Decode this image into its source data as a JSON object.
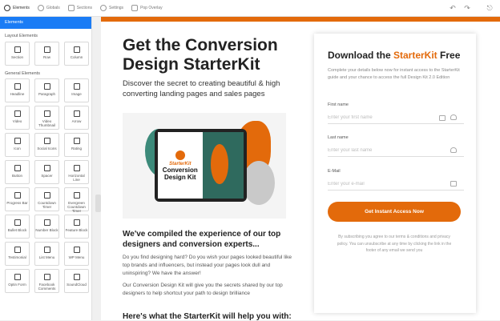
{
  "topbar": {
    "tabs": [
      {
        "label": "Elements",
        "icon": "plus-circle-icon"
      },
      {
        "label": "Globals",
        "icon": "globe-icon"
      },
      {
        "label": "Sections",
        "icon": "sections-icon"
      },
      {
        "label": "Settings",
        "icon": "gear-icon"
      },
      {
        "label": "Pop Overlay",
        "icon": "popup-icon"
      }
    ]
  },
  "sidebar": {
    "header": "Elements",
    "layout_title": "Layout Elements",
    "layout": [
      "Section",
      "Row",
      "Column"
    ],
    "general_title": "General Elements",
    "general": [
      "Headline",
      "Paragraph",
      "Image",
      "Video",
      "Video Thumbnail",
      "Arrow",
      "Icon",
      "Social Icons",
      "Rating",
      "Button",
      "Spacer",
      "Horizontal Line",
      "Progress Bar",
      "Countdown Timer",
      "Evergreen Countdown Timer",
      "Bullet Block",
      "Number Block",
      "Feature Block",
      "Testimonial",
      "List Menu",
      "WP Menu",
      "Optin Form",
      "Facebook Comments",
      "SoundCloud"
    ]
  },
  "page": {
    "accent": "#e36a0b",
    "title": "Get the Conversion Design StarterKit",
    "subtitle": "Discover the secret to creating beautiful & high converting landing pages and sales pages",
    "book": {
      "brand": "StarterKit",
      "title": "Conversion Design Kit"
    },
    "section_heading": "We've compiled the experience of our top designers and conversion experts...",
    "para1": "Do you find designing hard?  Do you wish your pages looked beautiful like top brands and influencers, but instead your pages look dull and uninspiring?  We have the answer!",
    "para2": "Our Conversion Design Kit will give you the secrets shared by our top designers to help shortcut your path to design brilliance",
    "section_heading2": "Here's what the StarterKit will help you with:"
  },
  "form": {
    "title_pre": "Download the ",
    "title_accent": "StarterKit",
    "title_post": " Free",
    "description": "Complete your details below now for instant access to the StarterKit guide and your chance to access the full Design Kit 2.0 Edition",
    "first_label": "First name",
    "first_placeholder": "Enter your first name",
    "last_label": "Last name",
    "last_placeholder": "Enter your last name",
    "email_label": "E-Mail",
    "email_placeholder": "Enter your e-mail",
    "button": "Get Instant Access Now",
    "note": "By subscribing you agree to our terms & conditions and privacy policy. You can unsubscribe at any time by clicking the link in the footer of any email we send you"
  }
}
